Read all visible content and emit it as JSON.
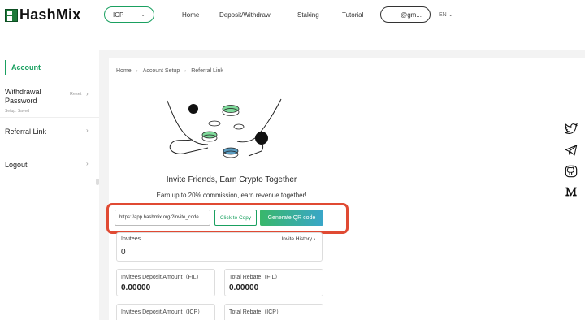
{
  "header": {
    "logo_text": "HashMix",
    "network": "ICP",
    "nav": [
      "Home",
      "Deposit/Withdraw",
      "Staking",
      "Tutorial"
    ],
    "account": "@gm...",
    "language": "EN"
  },
  "sidebar": {
    "account_label": "Account",
    "items": [
      {
        "label": "Withdrawal Password",
        "sub": "Setup: Saved",
        "action": "Reset"
      },
      {
        "label": "Referral Link"
      },
      {
        "label": "Logout"
      }
    ]
  },
  "breadcrumb": [
    "Home",
    "Account Setup",
    "Referral Link"
  ],
  "invite": {
    "title": "Invite Friends, Earn Crypto Together",
    "subtitle": "Earn up to 20% commission, earn revenue together!",
    "link_value": "https://app.hashmix.org/?invite_code...",
    "copy_label": "Click to Copy",
    "qr_label": "Generate QR code"
  },
  "stats": {
    "invitees_label": "Invitees",
    "invitees_value": "0",
    "invite_history_label": "Invite History",
    "fil_deposit_label": "Invitees Deposit Amount（FIL）",
    "fil_deposit_value": "0.00000",
    "fil_rebate_label": "Total Rebate（FIL）",
    "fil_rebate_value": "0.00000",
    "icp_deposit_label": "Invitees Deposit Amount（ICP）",
    "icp_rebate_label": "Total Rebate（ICP）"
  },
  "social": [
    "twitter-icon",
    "telegram-icon",
    "github-icon",
    "medium-icon"
  ],
  "colors": {
    "accent": "#1aa060",
    "highlight": "#e04a33"
  }
}
